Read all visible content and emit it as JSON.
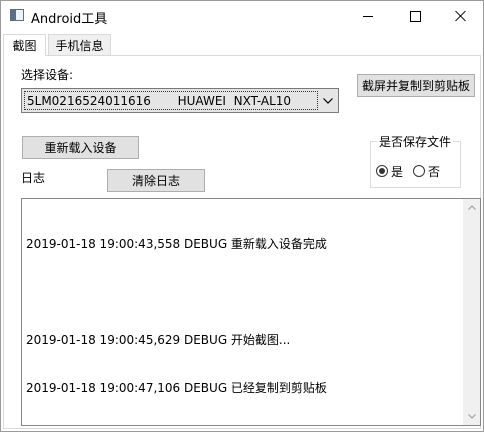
{
  "window": {
    "title": "Android工具",
    "controls": {
      "minimize": "minimize",
      "maximize": "maximize",
      "close": "close"
    }
  },
  "tabs": [
    {
      "label": "截图",
      "active": true
    },
    {
      "label": "手机信息",
      "active": false
    }
  ],
  "screenshot_tab": {
    "device_label": "选择设备:",
    "device_selected": "5LM0216524011616       HUAWEI  NXT-AL10",
    "capture_button": "截屏并复制到剪贴板",
    "reload_button": "重新载入设备",
    "log_label": "日志",
    "clear_log_button": "清除日志",
    "save_group": {
      "title": "是否保存文件",
      "options": [
        {
          "label": "是",
          "checked": true
        },
        {
          "label": "否",
          "checked": false
        }
      ]
    },
    "log_lines": [
      "2019-01-18 19:00:43,558 DEBUG 重新载入设备完成",
      "",
      "2019-01-18 19:00:45,629 DEBUG 开始截图...",
      "2019-01-18 19:00:47,106 DEBUG 已经复制到剪贴板"
    ]
  },
  "icons": {
    "app": "app-window-icon",
    "dropdown": "chevron-down-icon",
    "scroll_up": "scroll-up-arrow-icon",
    "scroll_down": "scroll-down-arrow-icon"
  }
}
